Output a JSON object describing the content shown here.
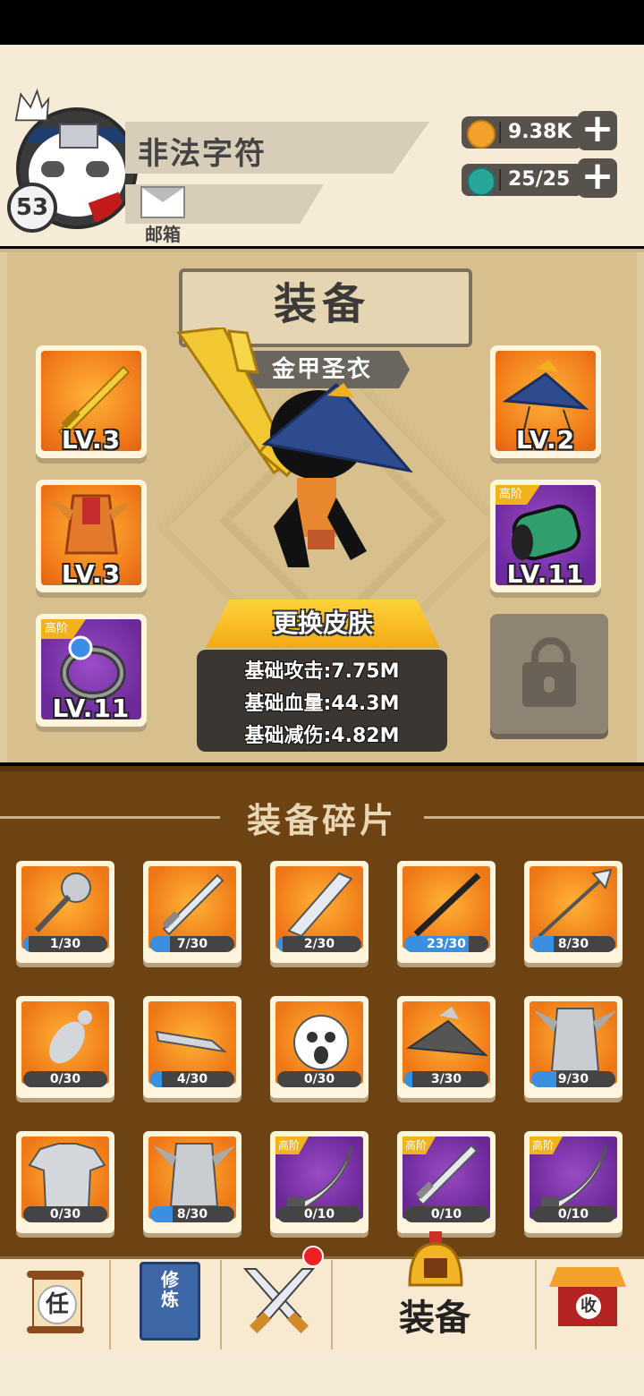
{
  "player": {
    "name": "非法字符",
    "level": "53",
    "mail_label": "邮箱"
  },
  "resources": {
    "coins": "9.38K",
    "energy": "25/25"
  },
  "panel": {
    "title": "装备",
    "skin_name": "金甲圣衣",
    "change_skin": "更换皮肤"
  },
  "equipment_slots": [
    {
      "level": "LV.3",
      "tier": "",
      "item": "sword-icon"
    },
    {
      "level": "LV.2",
      "tier": "",
      "item": "straw-hat-icon"
    },
    {
      "level": "LV.3",
      "tier": "",
      "item": "armor-icon"
    },
    {
      "level": "LV.11",
      "tier": "高阶",
      "item": "bracer-icon"
    },
    {
      "level": "LV.11",
      "tier": "高阶",
      "item": "ring-icon"
    }
  ],
  "stats": {
    "attack": "基础攻击:7.75M",
    "hp": "基础血量:44.3M",
    "defense": "基础减伤:4.82M"
  },
  "shards_title": "装备碎片",
  "shards": [
    {
      "count": "1/30",
      "progress": 0.033,
      "tier": "",
      "item": "mace-icon"
    },
    {
      "count": "7/30",
      "progress": 0.233,
      "tier": "",
      "item": "sword-icon"
    },
    {
      "count": "2/30",
      "progress": 0.067,
      "tier": "",
      "item": "blade-icon"
    },
    {
      "count": "23/30",
      "progress": 0.767,
      "tier": "",
      "item": "staff-icon"
    },
    {
      "count": "8/30",
      "progress": 0.267,
      "tier": "",
      "item": "spear-icon"
    },
    {
      "count": "0/30",
      "progress": 0,
      "tier": "",
      "item": "duck-icon"
    },
    {
      "count": "4/30",
      "progress": 0.133,
      "tier": "",
      "item": "key-blade-icon"
    },
    {
      "count": "0/30",
      "progress": 0,
      "tier": "",
      "item": "face-mask-icon"
    },
    {
      "count": "3/30",
      "progress": 0.1,
      "tier": "",
      "item": "straw-hat-icon"
    },
    {
      "count": "9/30",
      "progress": 0.3,
      "tier": "",
      "item": "armor-icon"
    },
    {
      "count": "0/30",
      "progress": 0,
      "tier": "",
      "item": "tshirt-icon"
    },
    {
      "count": "8/30",
      "progress": 0.267,
      "tier": "",
      "item": "armor-icon"
    },
    {
      "count": "0/10",
      "progress": 0,
      "tier": "高阶",
      "item": "sabre-icon"
    },
    {
      "count": "0/10",
      "progress": 0,
      "tier": "高阶",
      "item": "sword-icon"
    },
    {
      "count": "0/10",
      "progress": 0,
      "tier": "高阶",
      "item": "sabre-icon"
    }
  ],
  "nav": {
    "task_icon_text": "任",
    "cultivate_icon_text": "修炼",
    "equipment_label": "装备",
    "collect_icon_text": "收"
  },
  "colors": {
    "accent": "#f4a916",
    "panel": "#d8c08e",
    "shard_bg": "#6e4313",
    "progress": "#3a8fe0"
  }
}
